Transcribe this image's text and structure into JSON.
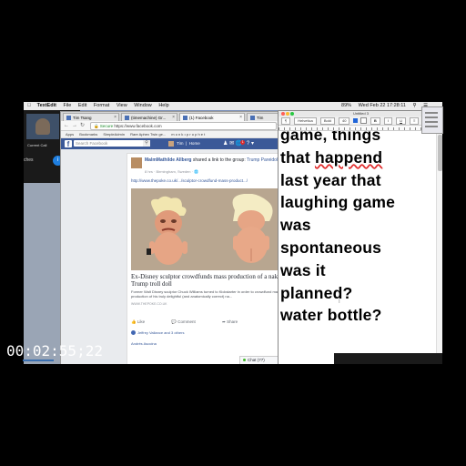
{
  "menubar": {
    "app": "TextEdit",
    "items": [
      "File",
      "Edit",
      "Format",
      "View",
      "Window",
      "Help"
    ],
    "clock": "Wed Feb 22  17:28:11",
    "battery": "89%"
  },
  "call": {
    "label": "Current Call",
    "name": "ches",
    "info_icon": "info-icon",
    "end_icon": "end-call-icon"
  },
  "browser": {
    "tabs": [
      {
        "label": "Tim Tsang",
        "active": false
      },
      {
        "label": "(timemachine) Gr...",
        "active": false
      },
      {
        "label": "(1) Facebook",
        "active": true
      },
      {
        "label": "Tim",
        "active": false
      }
    ],
    "url_secure": "Secure",
    "url": "https://www.facebook.com",
    "bookmarks": [
      "Apps",
      "Bookmarks",
      "SimpleAdmin",
      "Rare Aphex Twin ge...",
      "m o n k • p r o p h e t"
    ]
  },
  "facebook": {
    "search_placeholder": "Search Facebook",
    "user": "Tim",
    "home": "Home",
    "post": {
      "author": "MalmMathilde Allberg",
      "shared_text": "shared a link to the group:",
      "group": "Trump Pareidolia",
      "meta": "8 hrs · Birmingham, Sweden · 🌐",
      "link": "http://www.thepoke.co.uk/.../sculptor-crowdfund-mass-product.../",
      "title": "Ex-Disney sculptor crowdfunds mass production of a naked Trump troll doll",
      "description": "Former Walt Disney sculptor Chuck Williams turned to Kickstarter in order to crowdfund mass production of his truly delightful (and anatomically correct) na...",
      "source": "WWW.THEPOKE.CO.UK",
      "actions": [
        "Like",
        "Comment",
        "Share"
      ],
      "reactions": "Jeffrey Vallance and 3 others",
      "commenter": "Andrés Asocina"
    },
    "chat": "Chat (77)"
  },
  "textedit": {
    "title": "Untitled 3",
    "toolbar": {
      "style": "Helvetica",
      "font": "Bold",
      "size": "40"
    },
    "lines": [
      "game, things",
      "that happend",
      "last year that",
      "laughing game",
      "was",
      "spontaneous",
      "was it",
      "planned?",
      "water bottle?"
    ],
    "misspelled": "happend"
  },
  "timecode": "00:02:55;22"
}
